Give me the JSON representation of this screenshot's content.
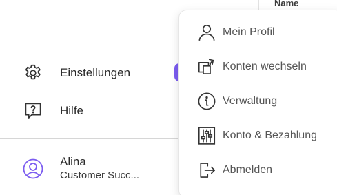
{
  "background": {
    "column_header": "Name"
  },
  "sidebar": {
    "items": [
      {
        "label": "Einstellungen",
        "icon": "gear-icon"
      },
      {
        "label": "Hilfe",
        "icon": "help-icon"
      }
    ],
    "user": {
      "name": "Alina",
      "role": "Customer Succ...",
      "icon": "user-avatar-icon"
    }
  },
  "menu": {
    "items": [
      {
        "label": "Mein Profil",
        "icon": "person-icon"
      },
      {
        "label": "Konten wechseln",
        "icon": "switch-account-icon"
      },
      {
        "label": "Verwaltung",
        "icon": "info-icon"
      },
      {
        "label": "Konto & Bezahlung",
        "icon": "sliders-icon"
      },
      {
        "label": "Abmelden",
        "icon": "logout-icon"
      }
    ]
  },
  "colors": {
    "accent": "#7b5cf0",
    "text": "#2a2a2a",
    "menu_text": "#555555"
  }
}
